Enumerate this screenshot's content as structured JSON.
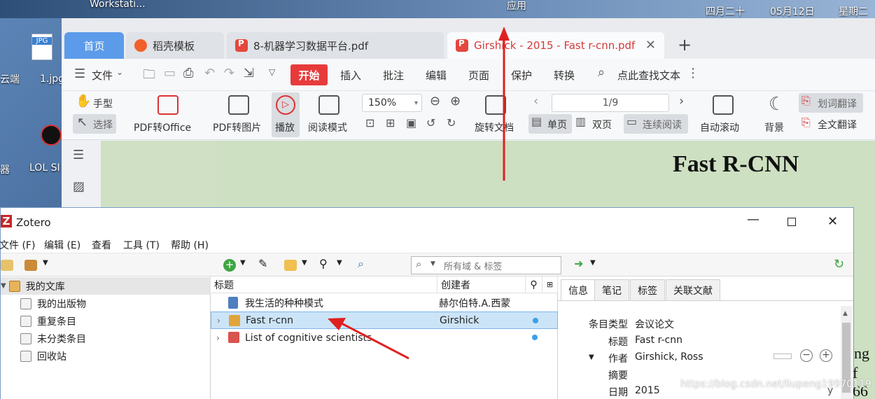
{
  "desktop": {
    "top_left_label": "Workstati...",
    "top_center_label": "应用",
    "date_1": "四月二十",
    "date_2": "05月12日",
    "weekday": "星期二",
    "icon_labels": [
      "云端",
      "1.jpg",
      "LOL SI",
      "器"
    ],
    "jpg_badge": "JPG"
  },
  "wps": {
    "tabs": [
      {
        "label": "首页"
      },
      {
        "label": "稻壳模板"
      },
      {
        "label": "8-机器学习数据平台.pdf"
      },
      {
        "label": "Girshick - 2015 - Fast r-cnn.pdf"
      }
    ],
    "menu": {
      "file": "文件",
      "start": "开始",
      "items": [
        "插入",
        "批注",
        "编辑",
        "页面",
        "保护",
        "转换"
      ],
      "search": "点此查找文本"
    },
    "ribbon": {
      "hand": "手型",
      "select": "选择",
      "pdf_to_office": "PDF转Office",
      "pdf_to_image": "PDF转图片",
      "play": "播放",
      "read_mode": "阅读模式",
      "zoom": "150%",
      "rotate": "旋转文档",
      "page": "1/9",
      "single": "单页",
      "double": "双页",
      "continuous": "连续阅读",
      "auto_scroll": "自动滚动",
      "background": "背景",
      "word_translate": "划词翻译",
      "full_translate": "全文翻译"
    },
    "doc_title": "Fast R-CNN"
  },
  "zotero": {
    "title": "Zotero",
    "menu": [
      "文件 (F)",
      "编辑 (E)",
      "查看",
      "工具 (T)",
      "帮助 (H)"
    ],
    "search_placeholder": "所有域 & 标签",
    "library": [
      {
        "label": "我的文库"
      },
      {
        "label": "我的出版物"
      },
      {
        "label": "重复条目"
      },
      {
        "label": "未分类条目"
      },
      {
        "label": "回收站"
      }
    ],
    "columns": {
      "title": "标题",
      "creator": "创建者"
    },
    "items": [
      {
        "title": "我生活的种种模式",
        "creator": "赫尔伯特.A.西蒙"
      },
      {
        "title": "Fast r-cnn",
        "creator": "Girshick"
      },
      {
        "title": "List of cognitive scientists",
        "creator": ""
      }
    ],
    "info_tabs": [
      "信息",
      "笔记",
      "标签",
      "关联文献"
    ],
    "info": {
      "item_type_label": "条目类型",
      "item_type": "会议论文",
      "title_label": "标题",
      "title": "Fast r-cnn",
      "author_label": "作者",
      "author": "Girshick, Ross",
      "abstract_label": "摘要",
      "date_label": "日期",
      "date": "2015",
      "y": "y"
    }
  },
  "background_text": {
    "right_1": "ng",
    "right_2": "f 66"
  },
  "watermark": "https://blog.csdn.net/liupeng19970119",
  "colors": {
    "arrow": "#e02020",
    "accent_red": "#e73b3b",
    "tab_blue": "#5b9bea"
  }
}
